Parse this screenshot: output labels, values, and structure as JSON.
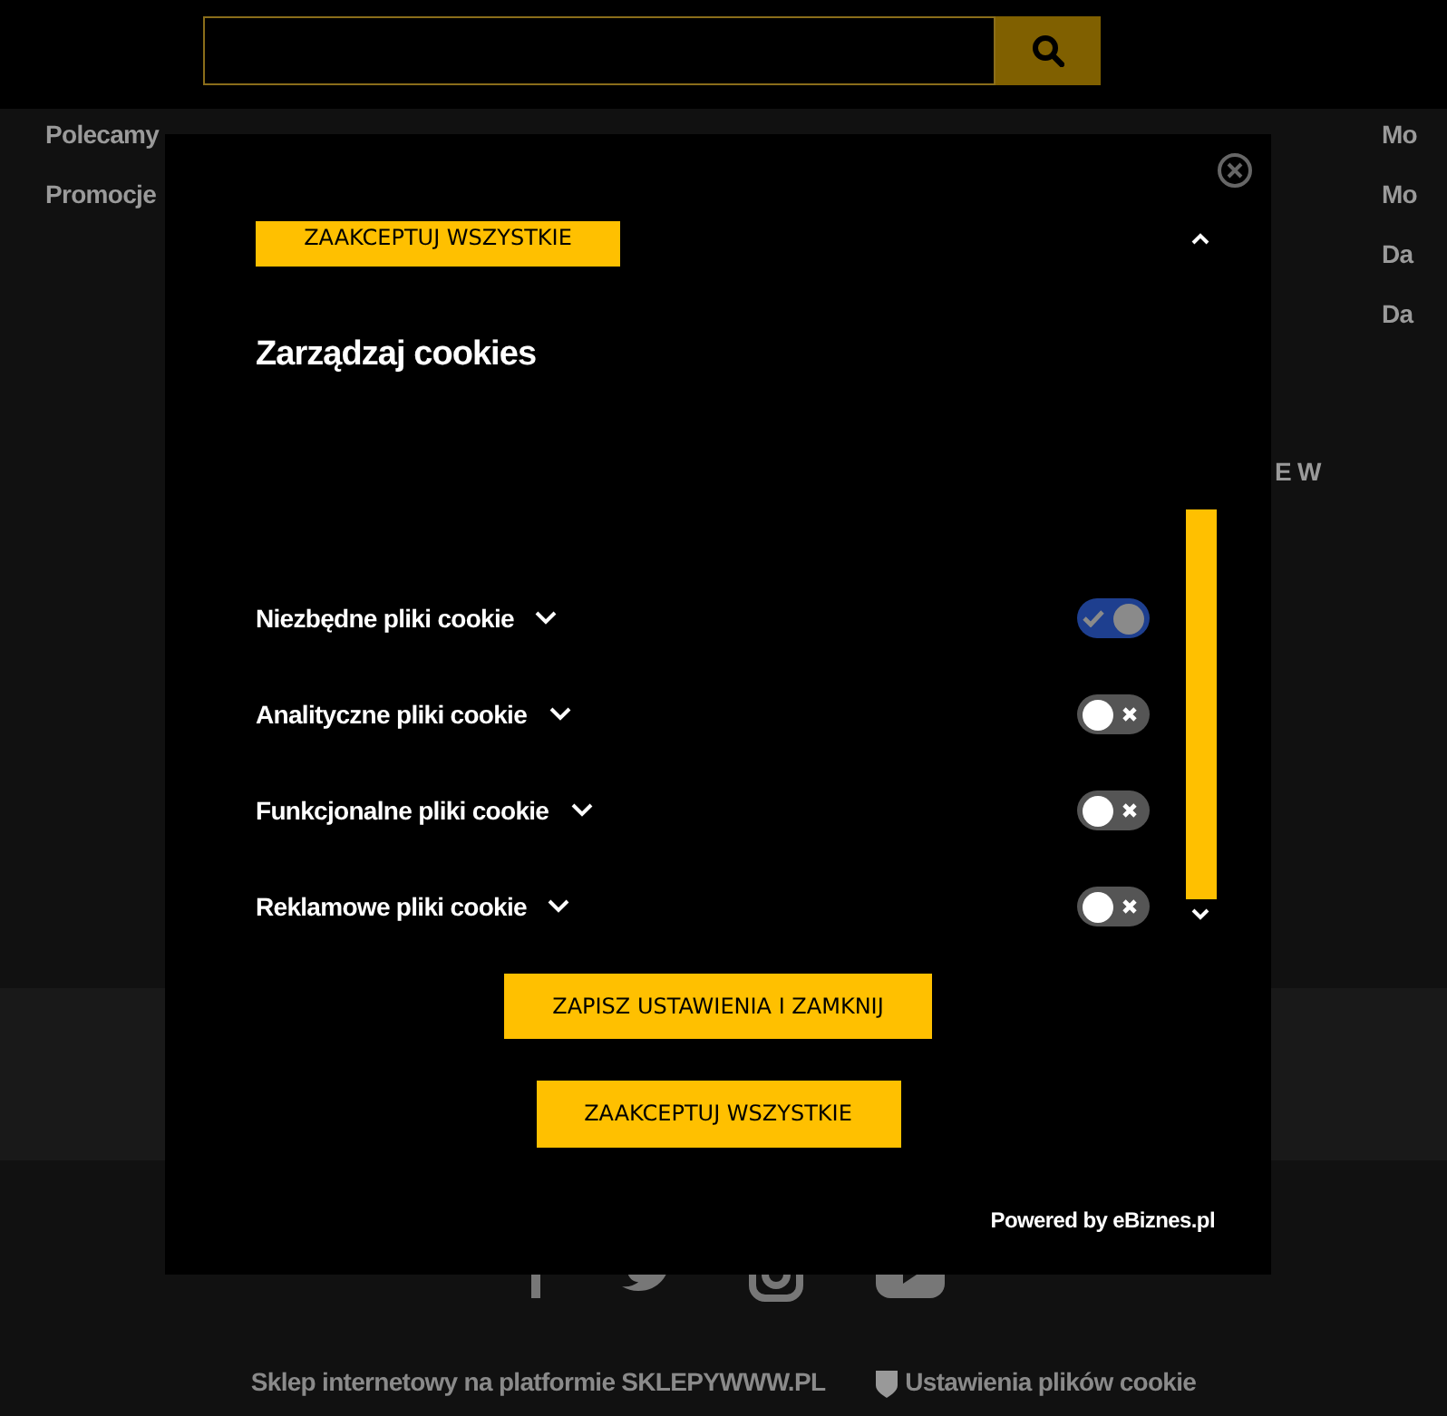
{
  "nav": {
    "left": [
      "Polecamy",
      "Promocje"
    ],
    "fragment": "E W",
    "right": [
      "Mo",
      "Mo",
      "Da",
      "Da"
    ]
  },
  "footer": {
    "platform": "Sklep internetowy na platformie SKLEPYWWW.PL",
    "cookie_settings": "Ustawienia plików cookie"
  },
  "modal": {
    "top_button": "ZAAKCEPTUJ WSZYSTKIE",
    "title": "Zarządzaj cookies",
    "categories": [
      {
        "label": "Niezbędne pliki cookie",
        "expanded": false,
        "checked": true
      },
      {
        "label": "Analityczne pliki cookie",
        "expanded": false,
        "checked": false
      },
      {
        "label": "Funkcjonalne pliki cookie",
        "expanded": false,
        "checked": false
      },
      {
        "label": "Reklamowe pliki cookie",
        "expanded": false,
        "checked": false
      }
    ],
    "save_button": "ZAPISZ USTAWIENIA I ZAMKNIJ",
    "accept_button": "ZAAKCEPTUJ WSZYSTKIE",
    "powered_by": "Powered by eBiznes.pl"
  }
}
